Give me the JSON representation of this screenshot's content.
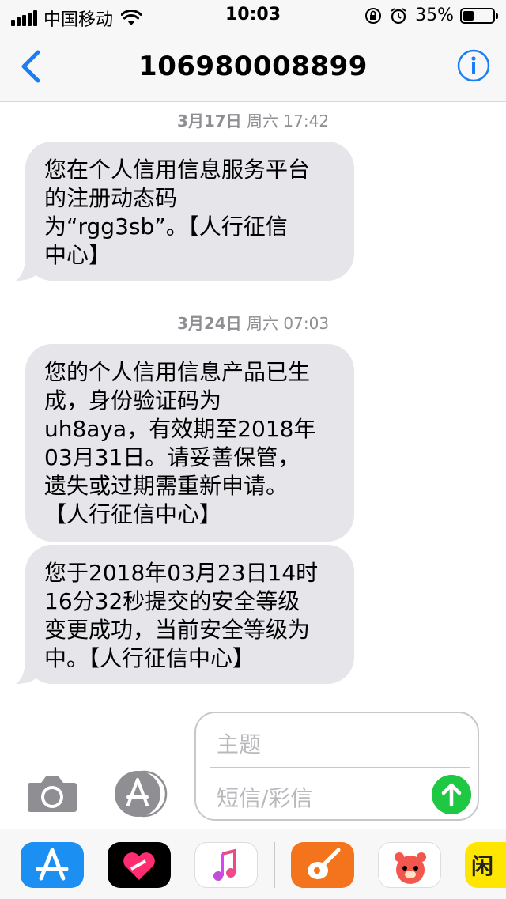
{
  "status_bar": {
    "carrier": "中国移动",
    "time": "10:03",
    "battery_percent": "35%",
    "battery_level": 0.35
  },
  "nav": {
    "title": "106980008899",
    "accent_color": "#1a7cf6"
  },
  "messages": [
    {
      "timestamp_date": "3月17日",
      "timestamp_day": "周六 17:42",
      "lines": [
        "您在个人信用信息服务平台",
        "的注册动态码",
        "为“rgg3sb”。【人行征信",
        "中心】"
      ]
    },
    {
      "timestamp_date": "3月24日",
      "timestamp_day": "周六 07:03",
      "lines": [
        "您的个人信用信息产品已生",
        "成，身份验证码为",
        "uh8aya，有效期至2018年",
        "03月31日。请妥善保管，",
        "遗失或过期需重新申请。",
        "【人行征信中心】"
      ]
    },
    {
      "lines": [
        "您于2018年03月23日14时",
        "16分32秒提交的安全等级",
        "变更成功，当前安全等级为",
        "中。【人行征信中心】"
      ]
    }
  ],
  "input": {
    "subject_placeholder": "主题",
    "body_placeholder": "短信/彩信",
    "send_color": "#1fc842"
  },
  "app_drawer": {
    "apps": [
      "app-store-icon",
      "digital-touch-icon",
      "music-icon",
      "garageband-icon",
      "bear-sticker-icon",
      "partial-app-icon"
    ]
  }
}
